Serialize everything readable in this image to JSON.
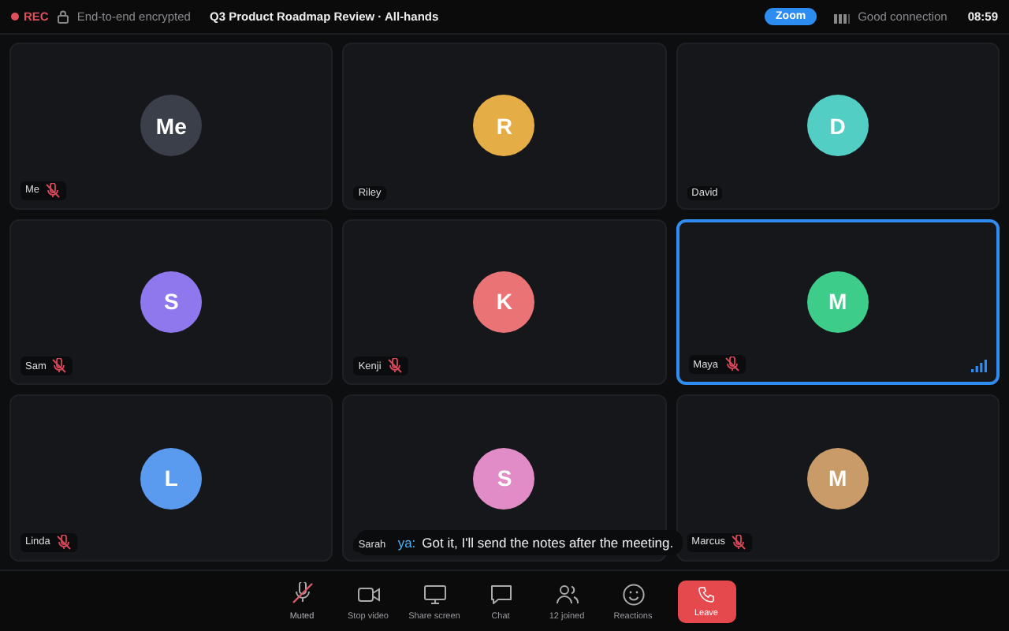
{
  "top_bar": {
    "recording": {
      "label": "REC",
      "on": true
    },
    "encryption": "End-to-end encrypted",
    "title": "Q3 Product Roadmap Review · All-hands",
    "zoom_button": "Zoom",
    "connection": "Good connection",
    "time": "08:59"
  },
  "tiles": [
    {
      "name": "Me",
      "initials": "Me",
      "color": "#3b3f4a",
      "muted": true,
      "speaking": false
    },
    {
      "name": "Riley",
      "initials": "R",
      "color": "#e5ad45",
      "muted": false,
      "speaking": false
    },
    {
      "name": "David",
      "initials": "D",
      "color": "#52cec4",
      "muted": false,
      "speaking": false
    },
    {
      "name": "Sam",
      "initials": "S",
      "color": "#8f78ee",
      "muted": true,
      "speaking": false
    },
    {
      "name": "Kenji",
      "initials": "K",
      "color": "#ea7475",
      "muted": true,
      "speaking": false
    },
    {
      "name": "Maya",
      "initials": "M",
      "color": "#3ecc8a",
      "muted": true,
      "speaking": true
    },
    {
      "name": "Linda",
      "initials": "L",
      "color": "#5a9bef",
      "muted": true,
      "speaking": false
    },
    {
      "name": "Sarah",
      "initials": "S",
      "color": "#e18cc6",
      "muted": false,
      "speaking": false,
      "caption": {
        "speaker": "ya:",
        "text": "Got it, I'll send the notes after the meeting."
      }
    },
    {
      "name": "Marcus",
      "initials": "M",
      "color": "#c89b68",
      "muted": true,
      "speaking": false
    }
  ],
  "toolbar": [
    {
      "kind": "mic",
      "label": "Muted",
      "on": false
    },
    {
      "kind": "video",
      "label": "Stop video"
    },
    {
      "kind": "screen",
      "label": "Share screen"
    },
    {
      "kind": "chat",
      "label": "Chat"
    },
    {
      "kind": "people",
      "label": "12 joined"
    },
    {
      "kind": "smile",
      "label": "Reactions"
    },
    {
      "kind": "leave",
      "label": "Leave"
    }
  ]
}
